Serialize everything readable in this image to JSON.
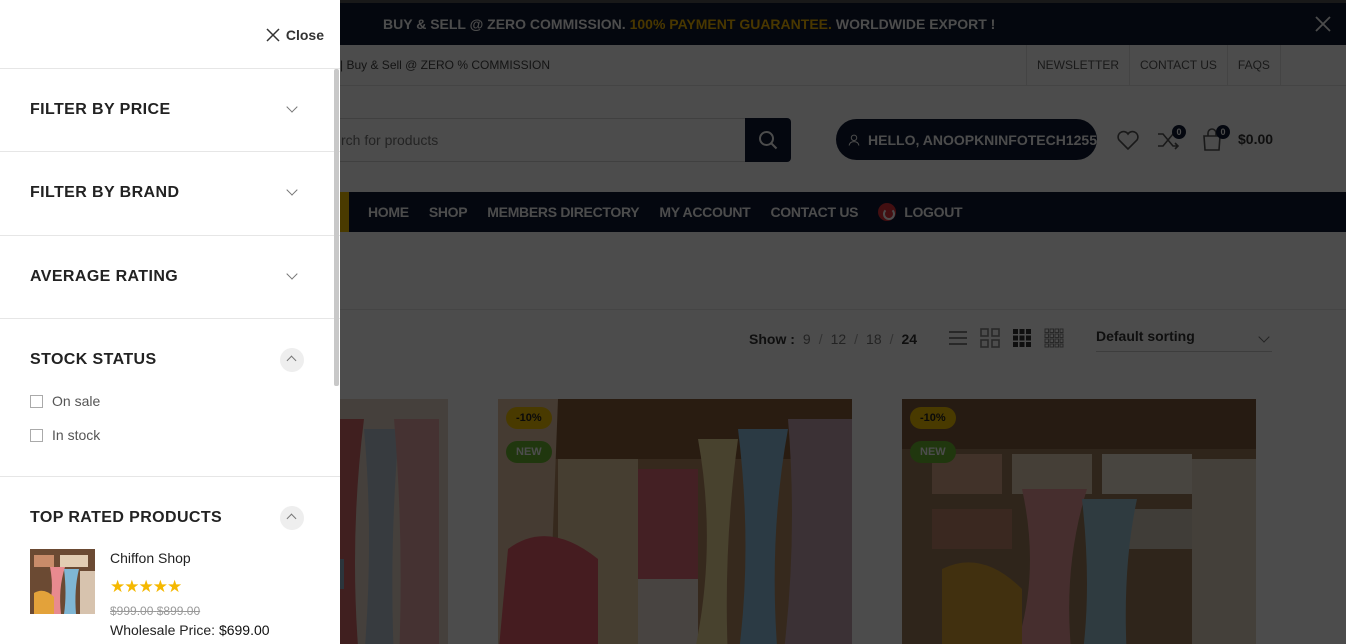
{
  "promo": {
    "part1": "BUY & SELL @ ZERO COMMISSION.",
    "highlight": "100% PAYMENT GUARANTEE.",
    "part2": "WORLDWIDE EXPORT !"
  },
  "subbar": {
    "marquee": "n | Buy & Sell @ ZERO % COMMISSION",
    "links": [
      "NEWSLETTER",
      "CONTACT US",
      "FAQS"
    ]
  },
  "header": {
    "search_placeholder": "rch for products",
    "hello": "HELLO, ANOOPKNINFOTECH1255",
    "compare_count": "0",
    "cart_count": "0",
    "cart_total": "$0.00"
  },
  "nav": {
    "items": [
      "HOME",
      "SHOP",
      "MEMBERS DIRECTORY",
      "MY ACCOUNT",
      "CONTACT US"
    ],
    "logout": "LOGOUT"
  },
  "toolbar": {
    "show_label": "Show :",
    "show_options": [
      "9",
      "12",
      "18",
      "24"
    ],
    "sorting": "Default sorting"
  },
  "products": [
    {
      "sale": "",
      "new": ""
    },
    {
      "sale": "-10%",
      "new": "NEW"
    },
    {
      "sale": "-10%",
      "new": "NEW"
    }
  ],
  "sidebar": {
    "close": "Close",
    "sections": [
      "FILTER BY PRICE",
      "FILTER BY BRAND",
      "AVERAGE RATING",
      "STOCK STATUS",
      "TOP RATED PRODUCTS"
    ],
    "stock": [
      "On sale",
      "In stock"
    ],
    "top_product": {
      "name": "Chiffon Shop",
      "stars": "★★★★★",
      "old_price": "$999.00",
      "price": "$899.00",
      "wholesale_label": "Wholesale Price:",
      "wholesale_price": "$699.00"
    }
  },
  "colors": {
    "navy": "#0e1a33",
    "accent_yellow": "#f5c200",
    "new_green": "#6bb830",
    "logout_red": "#e2323b"
  }
}
